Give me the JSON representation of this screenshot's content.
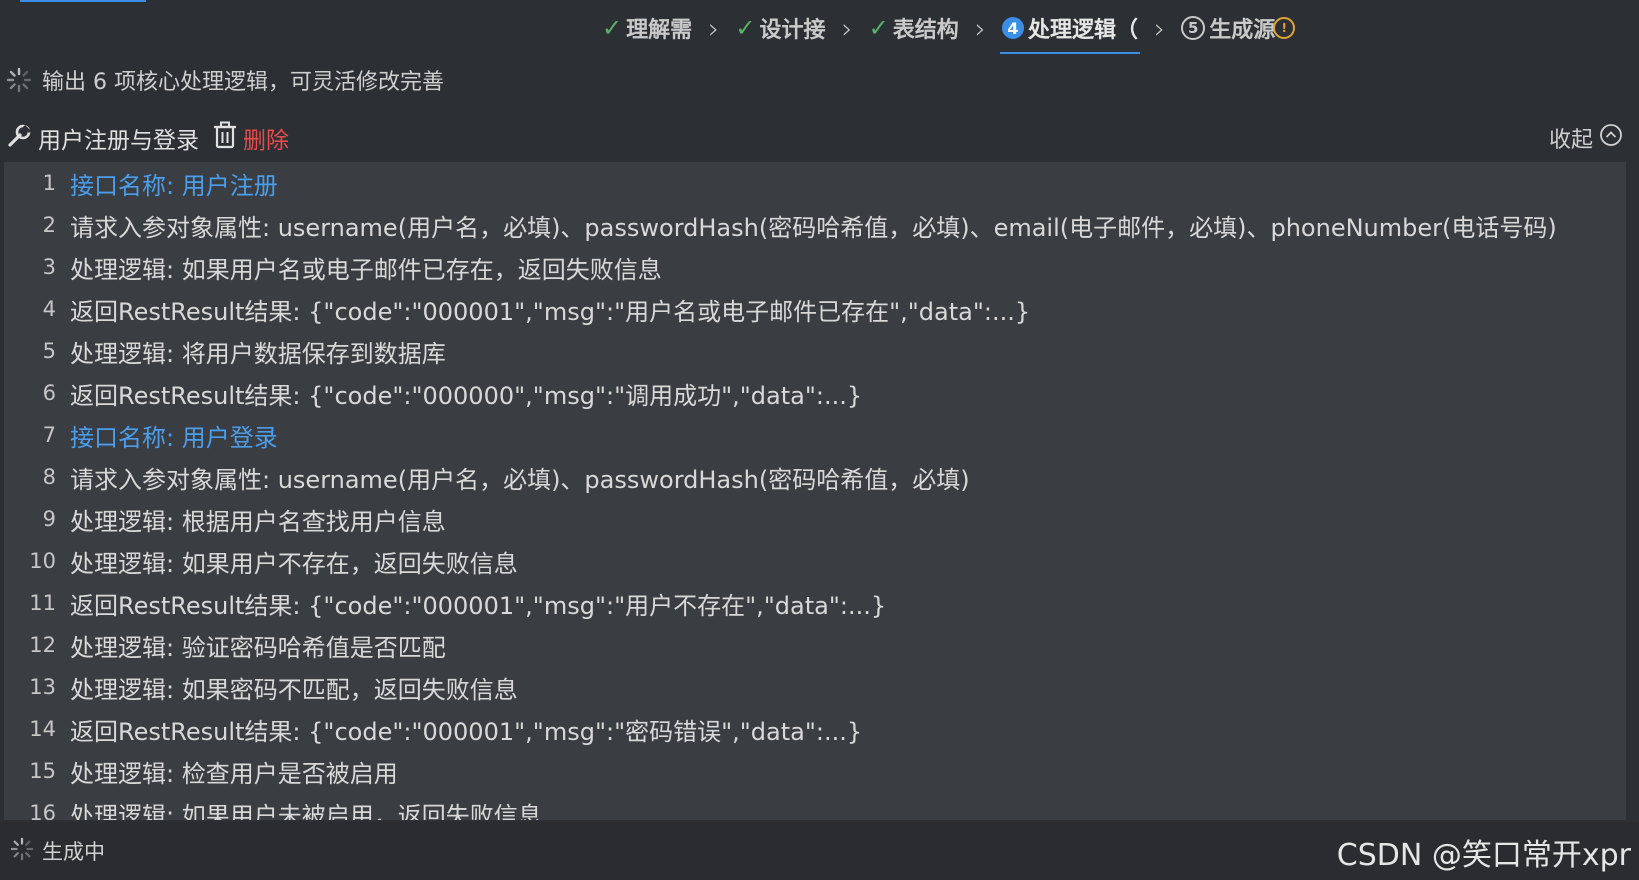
{
  "steps": [
    {
      "label": "理解需",
      "state": "done"
    },
    {
      "label": "设计接",
      "state": "done"
    },
    {
      "label": "表结构",
      "state": "done"
    },
    {
      "label": "处理逻辑（",
      "state": "active",
      "number": "4"
    },
    {
      "label": "生成源",
      "state": "pending",
      "number": "5"
    }
  ],
  "status": {
    "text": "输出 6 项核心处理逻辑，可灵活修改完善"
  },
  "section": {
    "title": "用户注册与登录",
    "delete_label": "删除",
    "collapse_label": "收起"
  },
  "code_lines": [
    {
      "n": "1",
      "text": "接口名称: 用户注册",
      "heading": true
    },
    {
      "n": "2",
      "text": "请求入参对象属性: username(用户名，必填)、passwordHash(密码哈希值，必填)、email(电子邮件，必填)、phoneNumber(电话号码)",
      "heading": false
    },
    {
      "n": "3",
      "text": "处理逻辑: 如果用户名或电子邮件已存在，返回失败信息",
      "heading": false
    },
    {
      "n": "4",
      "text": "返回RestResult结果: {\"code\":\"000001\",\"msg\":\"用户名或电子邮件已存在\",\"data\":...}",
      "heading": false
    },
    {
      "n": "5",
      "text": "处理逻辑: 将用户数据保存到数据库",
      "heading": false
    },
    {
      "n": "6",
      "text": "返回RestResult结果: {\"code\":\"000000\",\"msg\":\"调用成功\",\"data\":...}",
      "heading": false
    },
    {
      "n": "7",
      "text": "接口名称: 用户登录",
      "heading": true
    },
    {
      "n": "8",
      "text": "请求入参对象属性: username(用户名，必填)、passwordHash(密码哈希值，必填)",
      "heading": false
    },
    {
      "n": "9",
      "text": "处理逻辑: 根据用户名查找用户信息",
      "heading": false
    },
    {
      "n": "10",
      "text": "处理逻辑: 如果用户不存在，返回失败信息",
      "heading": false
    },
    {
      "n": "11",
      "text": "返回RestResult结果: {\"code\":\"000001\",\"msg\":\"用户不存在\",\"data\":...}",
      "heading": false
    },
    {
      "n": "12",
      "text": "处理逻辑: 验证密码哈希值是否匹配",
      "heading": false
    },
    {
      "n": "13",
      "text": "处理逻辑: 如果密码不匹配，返回失败信息",
      "heading": false
    },
    {
      "n": "14",
      "text": "返回RestResult结果: {\"code\":\"000001\",\"msg\":\"密码错误\",\"data\":...}",
      "heading": false
    },
    {
      "n": "15",
      "text": "处理逻辑: 检查用户是否被启用",
      "heading": false
    },
    {
      "n": "16",
      "text": "处理逻辑: 如果用户未被启用，返回失败信息",
      "heading": false
    }
  ],
  "bottom": {
    "status_text": "生成中",
    "watermark": "CSDN @笑口常开xpr"
  },
  "colors": {
    "accent": "#3a8ee6",
    "done": "#58b368",
    "danger": "#e84b4b",
    "heading": "#4a9eed"
  }
}
